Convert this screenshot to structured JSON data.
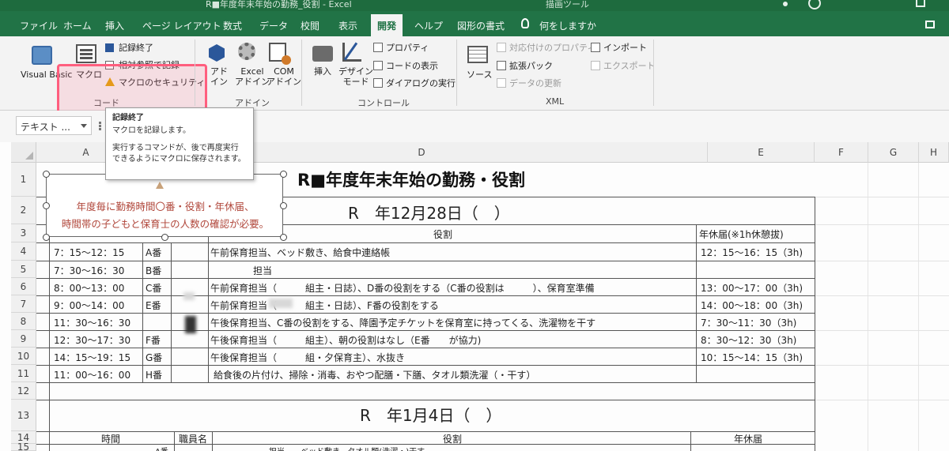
{
  "titlebar": {
    "title": "R■年度年末年始の勤務_役割 - Excel",
    "context_tab": "描画ツール"
  },
  "tabs": [
    "ファイル",
    "ホーム",
    "挿入",
    "ページ レイアウト",
    "数式",
    "データ",
    "校閲",
    "表示",
    "開発",
    "ヘルプ",
    "図形の書式",
    "何をしますか"
  ],
  "active_tab": "開発",
  "ribbon": {
    "code": {
      "visual_basic": "Visual Basic",
      "macro": "マクロ",
      "record_stop": "記録終了",
      "relative_ref": "相対参照で記録",
      "macro_security": "マクロのセキュリティ",
      "group": "コード"
    },
    "addins": {
      "addin_line1": "アド",
      "addin_line2": "イン",
      "excel_line1": "Excel",
      "excel_line2": "アドイン",
      "com_line1": "COM",
      "com_line2": "アドイン",
      "group": "アドイン"
    },
    "controls": {
      "insert": "挿入",
      "design_line1": "デザイン",
      "design_line2": "モード",
      "properties": "プロパティ",
      "view_code": "コードの表示",
      "run_dialog": "ダイアログの実行",
      "group": "コントロール"
    },
    "xml": {
      "source": "ソース",
      "map_properties": "対応付けのプロパティ",
      "expansion_packs": "拡張パック",
      "refresh_data": "データの更新",
      "import": "インポート",
      "export": "エクスポート",
      "group": "XML"
    }
  },
  "name_box": "テキスト ...",
  "tooltip": {
    "title": "記録終了",
    "line1": "マクロを記録します。",
    "line2": "実行するコマンドが、後で再度実行",
    "line3": "できるようにマクロに保存されます。"
  },
  "columns": [
    "A",
    "D",
    "E",
    "F",
    "G",
    "H"
  ],
  "rows": [
    "1",
    "2",
    "3",
    "4",
    "5",
    "6",
    "7",
    "8",
    "9",
    "10",
    "11",
    "12",
    "13",
    "14",
    "15"
  ],
  "shape": {
    "line1": "年度毎に勤務時間〇番・役割・年休届、",
    "line2": "時間帯の子どもと保育士の人数の確認が必要。"
  },
  "sheet": {
    "title": "R■年度年末年始の勤務・役割",
    "date1": "R　年12月28日（　）",
    "header_role": "役割",
    "header_leave": "年休届(※1h休憩拔)",
    "rows": [
      {
        "time": "7：15～12：15",
        "code": "A番",
        "role": "午前保育担当、ベッド敷き、給食中連絡帳",
        "leave": "12：15～16：15（3h)"
      },
      {
        "time": "7：30～16：30",
        "code": "B番",
        "role": "担当",
        "leave": ""
      },
      {
        "time": "8：00～13：00",
        "code": "C番",
        "role": "午前保育担当（　　　組主・日誌）、D番の役割をする（C番の役割は　　　）、保育室準備",
        "leave": "13：00～17：00（3h)"
      },
      {
        "time": "9：00～14：00",
        "code": "E番",
        "role": "午前保育担当（　　　組主・日誌）、F番の役割をする",
        "leave": "14：00～18：00（3h)"
      },
      {
        "time": "11：30～16：30",
        "code": "",
        "role": "午後保育担当、C番の役割をする、降園予定チケットを保育室に持ってくる、洗濯物を干す",
        "leave": "7：30～11：30（3h)"
      },
      {
        "time": "12：30～17：30",
        "code": "F番",
        "role": "午後保育担当（　　　組主）、朝の役割はなし（E番　　が協力)",
        "leave": "8：30～12：30（3h)"
      },
      {
        "time": "14：15～19：15",
        "code": "G番",
        "role": "午後保育担当（　　　組・夕保育主）、水抜き",
        "leave": "10：15～14：15（3h)"
      },
      {
        "time": "11：00～16：00",
        "code": "H番",
        "role": "給食後の片付け、掃除・消毒、おやつ配膳・下膳、タオル類洗濯（・干す）",
        "leave": ""
      }
    ],
    "date2": "R　年1月4日（　）",
    "header_time": "時間",
    "header_staff": "職員名",
    "header_role2": "役割",
    "header_leave2": "年休届",
    "row15_code": "A番",
    "row15_role": "…担当、…ベッド敷き、タオル類(洗濯・)干す"
  }
}
